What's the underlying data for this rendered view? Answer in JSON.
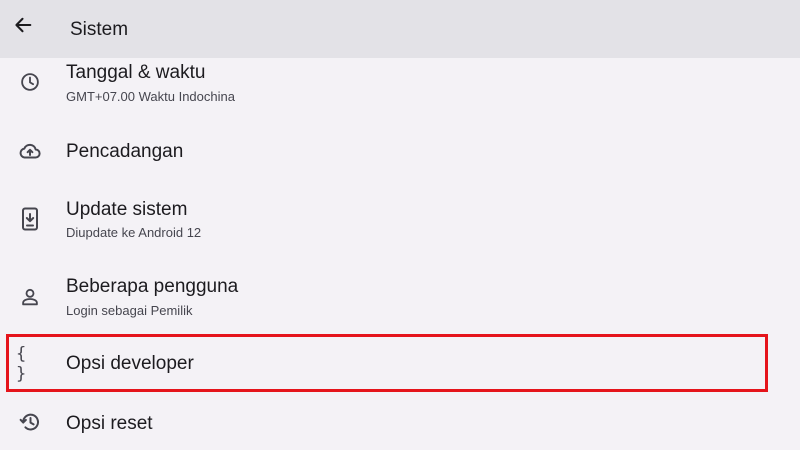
{
  "appbar": {
    "back_icon": "arrow-back-icon",
    "title": "Sistem"
  },
  "items": [
    {
      "icon": "clock-icon",
      "title": "Tanggal & waktu",
      "subtitle": "GMT+07.00 Waktu Indochina"
    },
    {
      "icon": "cloud-upload-icon",
      "title": "Pencadangan"
    },
    {
      "icon": "system-update-icon",
      "title": "Update sistem",
      "subtitle": "Diupdate ke Android 12"
    },
    {
      "icon": "person-icon",
      "title": "Beberapa pengguna",
      "subtitle": "Login sebagai Pemilik"
    },
    {
      "icon": "braces-icon",
      "icon_text": "{ }",
      "title": "Opsi developer"
    },
    {
      "icon": "history-icon",
      "title": "Opsi reset"
    }
  ],
  "highlight": {
    "target": "Opsi developer",
    "color": "#e5141b"
  },
  "colors": {
    "background": "#f4f2f6",
    "appbar": "#e3e2e7",
    "icon": "#46464f",
    "text_primary": "#1c1b1f",
    "text_secondary": "#46464f"
  }
}
